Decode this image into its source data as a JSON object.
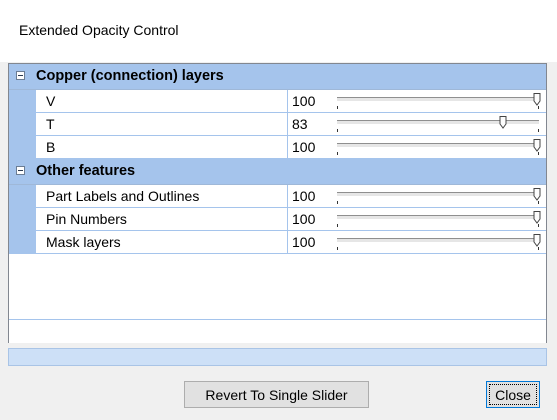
{
  "window": {
    "title": "Extended Opacity Control"
  },
  "groups": [
    {
      "label": "Copper (connection) layers",
      "expanded": true,
      "rows": [
        {
          "name": "V",
          "value": "100",
          "level": 100
        },
        {
          "name": "T",
          "value": "83",
          "level": 83
        },
        {
          "name": "B",
          "value": "100",
          "level": 100
        }
      ]
    },
    {
      "label": "Other features",
      "expanded": true,
      "rows": [
        {
          "name": "Part Labels and Outlines",
          "value": "100",
          "level": 100
        },
        {
          "name": "Pin Numbers",
          "value": "100",
          "level": 100
        },
        {
          "name": "Mask layers",
          "value": "100",
          "level": 100
        }
      ]
    }
  ],
  "buttons": {
    "revert_label": "Revert To Single Slider",
    "close_label": "Close"
  },
  "colors": {
    "group_header": "#a5c4ec",
    "grid_line": "#a5c4ec",
    "status_bar": "#cde0f7",
    "focus_border": "#0078d7"
  }
}
